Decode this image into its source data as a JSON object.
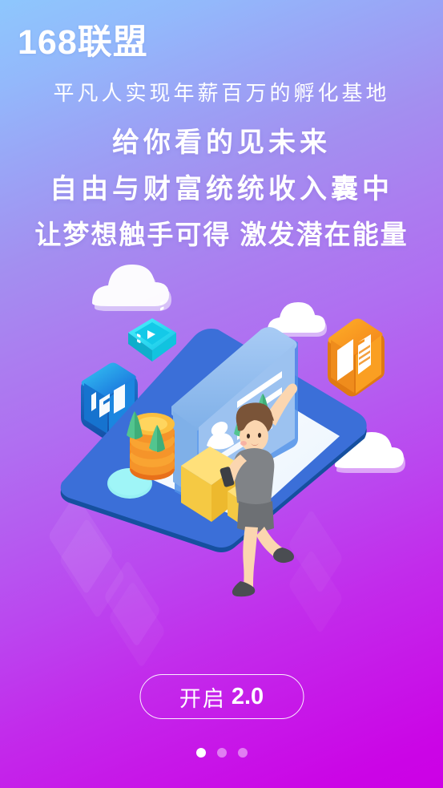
{
  "app": {
    "logo_text": "168联盟",
    "subtitle": "平凡人实现年薪百万的孵化基地"
  },
  "headlines": [
    "给你看的见未来",
    "自由与财富统统收入囊中",
    "让梦想触手可得 激发潜在能量"
  ],
  "cta": {
    "label": "开启",
    "version": "2.0"
  },
  "pager": {
    "total": 3,
    "active_index": 0
  },
  "illustration": {
    "badge_168_text": "168",
    "icons": [
      "cloud-icon",
      "video-film-icon",
      "badge-168-icon",
      "document-icon",
      "coin-stack-icon",
      "gold-bar-icon",
      "tree-icon",
      "smartphone-icon",
      "profile-card-icon",
      "running-person-icon"
    ]
  },
  "colors": {
    "gradient_start": "#8ec7fd",
    "gradient_mid": "#b06ef1",
    "gradient_end": "#cc00e6",
    "text_white": "#ffffff",
    "icon_blue": "#1f7fe0",
    "icon_cyan": "#2ee0f0",
    "icon_orange": "#f5921e",
    "gold": "#f7c63e",
    "coin_orange": "#f07c1e",
    "phone_blue": "#3b6fd8",
    "phone_blue_dark": "#1a4fae",
    "card_blue": "#8fb8ef",
    "tree_green": "#4fc08a",
    "skin": "#fbd6b0",
    "shirt_grey": "#808387",
    "hair_brown": "#7a5438"
  }
}
